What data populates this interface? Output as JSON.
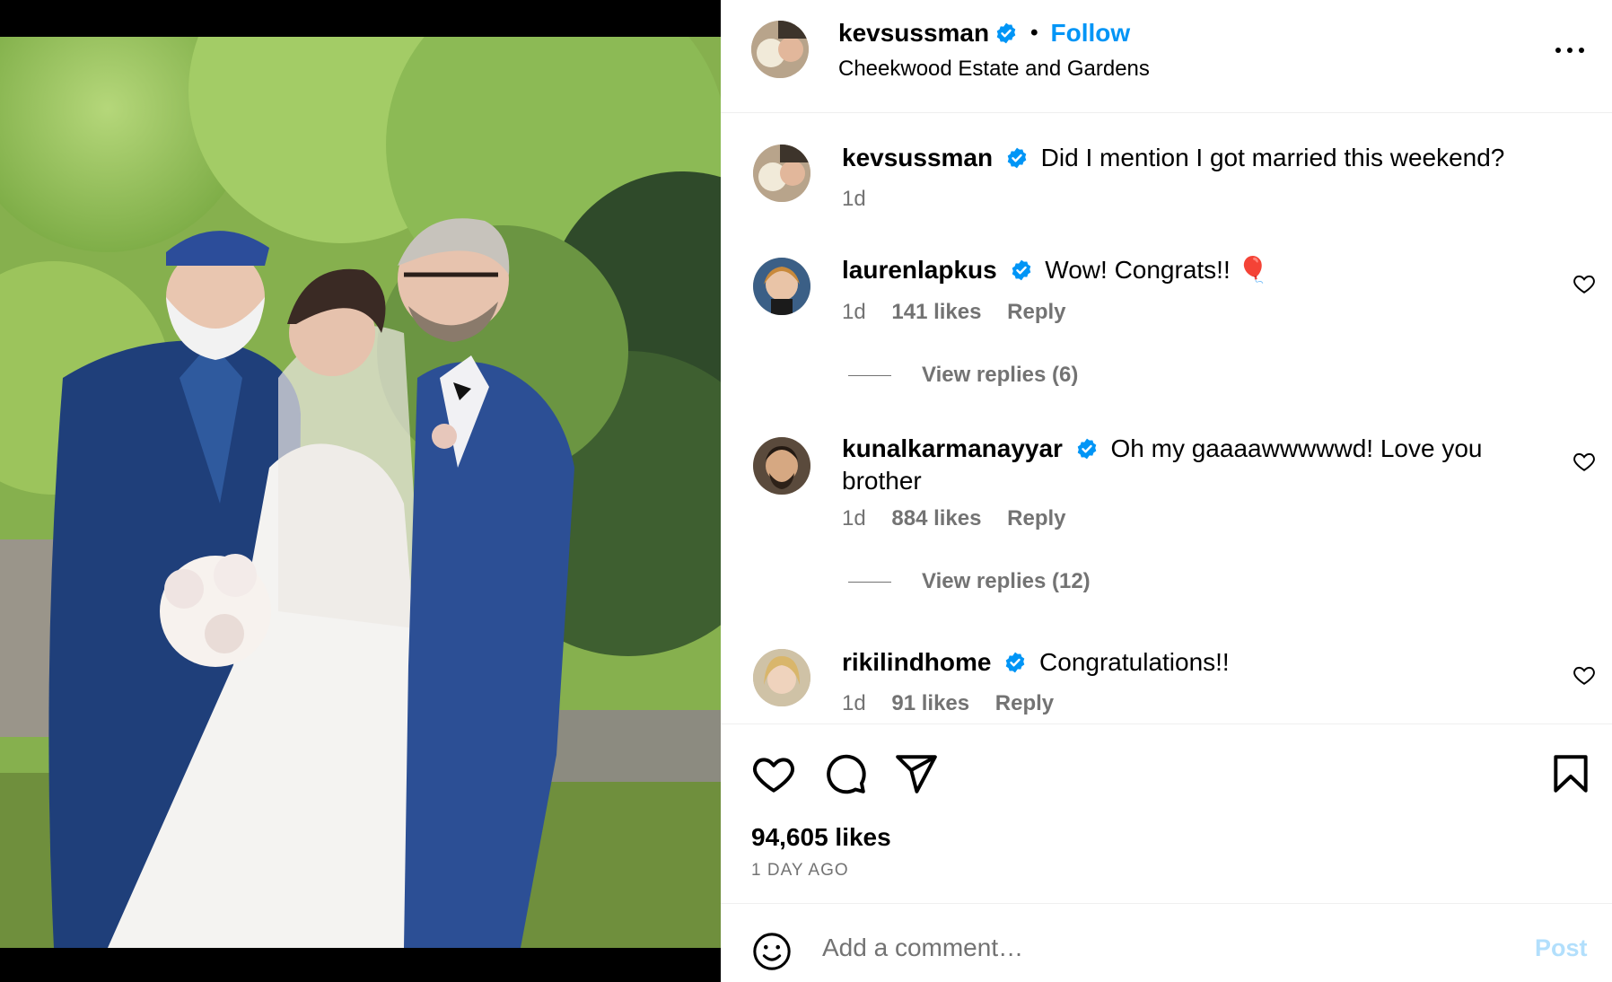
{
  "post": {
    "author": "kevsussman",
    "location": "Cheekwood Estate and Gardens",
    "follow_label": "Follow",
    "separator": "•",
    "likes_text": "94,605 likes",
    "date_text": "1 DAY AGO",
    "more_icon": "more-horizontal-icon"
  },
  "caption": {
    "user": "kevsussman",
    "text": "Did I mention I got married this weekend?",
    "time": "1d"
  },
  "comments": [
    {
      "user": "laurenlapkus",
      "text": "Wow! Congrats!! 🎈",
      "time": "1d",
      "likes": "141 likes",
      "reply_label": "Reply",
      "view_replies": "View replies (6)"
    },
    {
      "user": "kunalkarmanayyar",
      "text": "Oh my gaaaawwwwwd! Love you brother",
      "time": "1d",
      "likes": "884 likes",
      "reply_label": "Reply",
      "view_replies": "View replies (12)"
    },
    {
      "user": "rikilindhome",
      "text": "Congratulations!!",
      "time": "1d",
      "likes": "91 likes",
      "reply_label": "Reply"
    }
  ],
  "composer": {
    "placeholder": "Add a comment…",
    "post_label": "Post"
  },
  "colors": {
    "accent": "#0095f6",
    "muted": "#737373",
    "post_disabled": "#b2dffc",
    "verified": "#0095f6"
  },
  "icons": [
    "heart-icon",
    "comment-icon",
    "share-icon",
    "bookmark-icon",
    "emoji-icon",
    "verified-badge-icon"
  ]
}
